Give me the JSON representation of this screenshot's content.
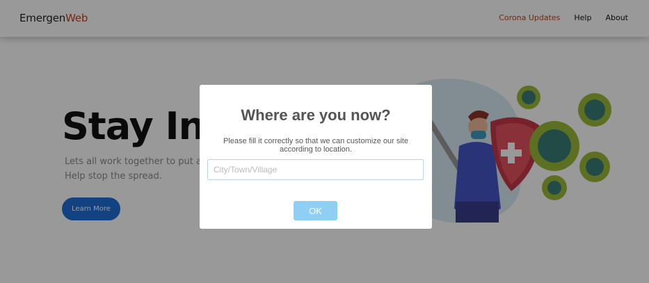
{
  "navbar": {
    "logo_main": "Emergen",
    "logo_accent": "Web",
    "links": [
      "Corona Updates",
      "Help",
      "About"
    ]
  },
  "hero": {
    "title_main": "Stay In.",
    "title_accent": "S",
    "text_line1": "Lets all work together to put an e",
    "text_line2": "Help stop the spread.",
    "button_label": "Learn More"
  },
  "modal": {
    "title": "Where are you now?",
    "text": "Please fill it correctly so that we can customize our site according to location.",
    "input_placeholder": "City/Town/Village",
    "input_value": "",
    "ok_label": "OK"
  },
  "colors": {
    "accent": "#c0441d",
    "primary_button": "#1e6fd9",
    "ok_button": "#8ecff3",
    "virus": "#9bbb3a"
  }
}
